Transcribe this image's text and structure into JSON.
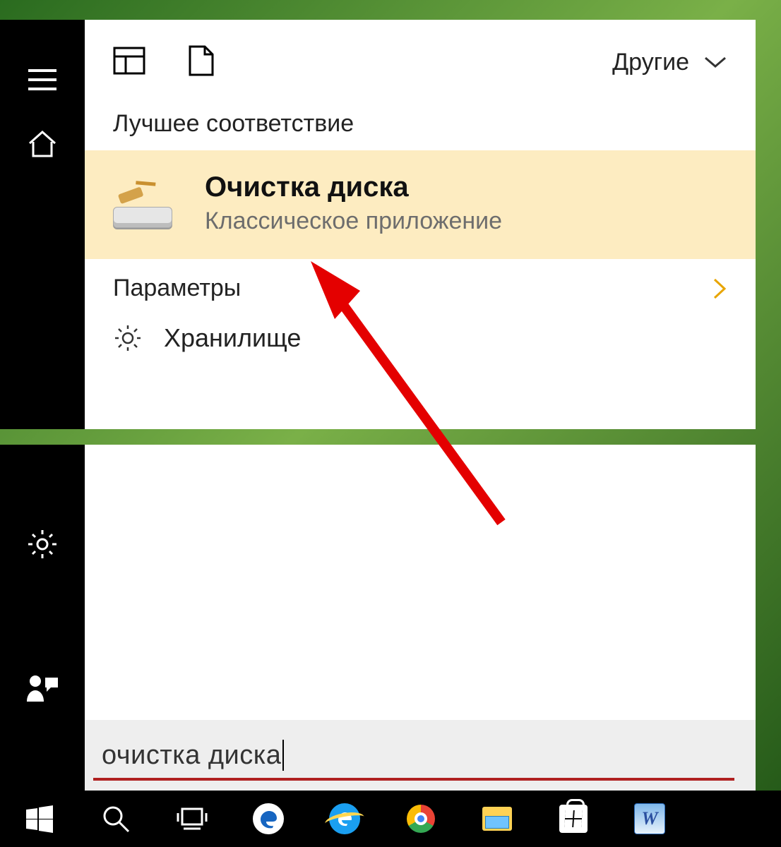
{
  "header": {
    "other_label": "Другие"
  },
  "sections": {
    "best_match_header": "Лучшее соответствие",
    "settings_header": "Параметры"
  },
  "best_match": {
    "title": "Очистка диска",
    "subtitle": "Классическое приложение"
  },
  "settings_items": [
    {
      "icon": "gear-icon",
      "label": "Хранилище"
    }
  ],
  "search": {
    "value": "очистка диска"
  },
  "sidebar_icons": [
    "menu-icon",
    "home-icon"
  ],
  "lower_sidebar_icons": [
    "settings-gear-icon",
    "user-ask-icon"
  ],
  "taskbar": {
    "items": [
      {
        "name": "start-button",
        "icon": "windows-icon"
      },
      {
        "name": "search-button",
        "icon": "search-icon"
      },
      {
        "name": "task-view-button",
        "icon": "task-view-icon"
      },
      {
        "name": "edge-app",
        "icon": "edge-icon"
      },
      {
        "name": "ie-app",
        "icon": "ie-icon"
      },
      {
        "name": "chrome-app",
        "icon": "chrome-icon"
      },
      {
        "name": "file-explorer-app",
        "icon": "explorer-icon"
      },
      {
        "name": "store-app",
        "icon": "store-icon"
      },
      {
        "name": "word-app",
        "icon": "word-icon"
      }
    ]
  },
  "colors": {
    "highlight": "#FDECC1",
    "annotation": "#E40000",
    "accent": "#E8A500"
  }
}
